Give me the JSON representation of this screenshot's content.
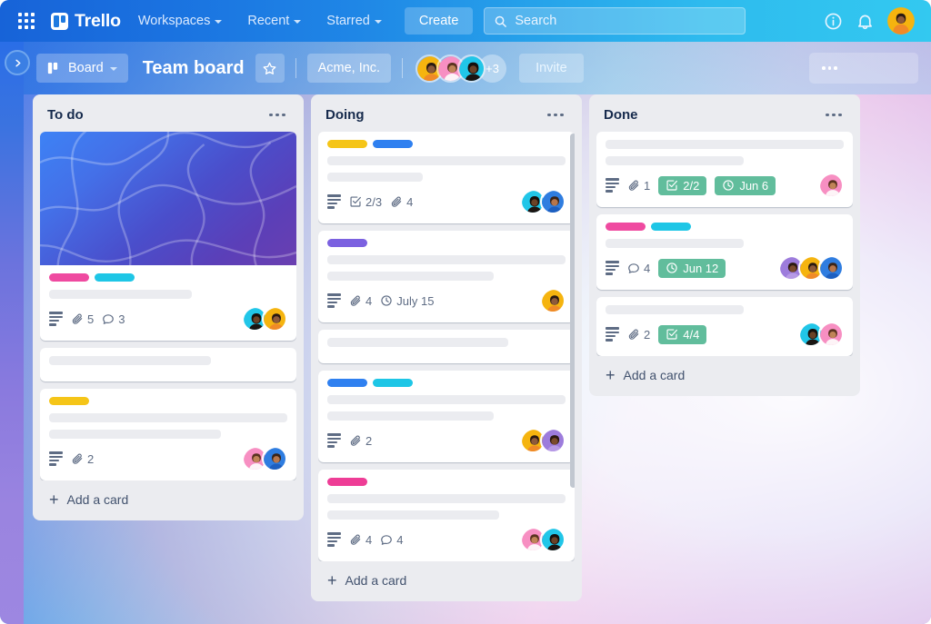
{
  "topnav": {
    "apps_icon": "grid-apps-icon",
    "brand": "Trello",
    "items": [
      {
        "label": "Workspaces",
        "icon": "chevron-down-icon"
      },
      {
        "label": "Recent",
        "icon": "chevron-down-icon"
      },
      {
        "label": "Starred",
        "icon": "chevron-down-icon"
      }
    ],
    "create_label": "Create",
    "search": {
      "placeholder": "Search",
      "icon": "search-icon",
      "value": ""
    },
    "info_icon": "info-circle-icon",
    "notifications_icon": "bell-icon",
    "profile_icon": "user-avatar"
  },
  "boardbar": {
    "sidebar_toggle_icon": "chevron-right-icon",
    "view_label": "Board",
    "view_icon": "board-view-icon",
    "view_caret": "chevron-down-icon",
    "title": "Team board",
    "star_icon": "star-outline-icon",
    "workspace": "Acme, Inc.",
    "member_overflow": "+3",
    "invite_label": "Invite",
    "menu_icon": "ellipsis-icon"
  },
  "colors": {
    "label_pink": "#ef4aa0",
    "label_cyan": "#1ec6e6",
    "label_yellow": "#f5c518",
    "label_blue": "#2f80f0",
    "label_purple": "#7b61e0",
    "label_magenta": "#ee3d96",
    "badge_green": "#61bd9c",
    "list_bg": "#ebecf0",
    "card_bg": "#ffffff",
    "text_dark": "#172b4d"
  },
  "lists": [
    {
      "title": "To do",
      "menu_icon": "ellipsis-icon",
      "add_card_label": "Add a card",
      "scrollbar": false,
      "cards": [
        {
          "cover": true,
          "labels": [
            "#ef4aa0",
            "#1ec6e6"
          ],
          "label_widths": [
            44,
            44
          ],
          "skeletons": [
            [
              60
            ]
          ],
          "badges": [
            {
              "type": "description"
            },
            {
              "type": "attachment",
              "value": "5"
            },
            {
              "type": "comment",
              "value": "3"
            }
          ],
          "avatars": [
            "teal",
            "yellow"
          ]
        },
        {
          "cover": false,
          "labels": [],
          "label_widths": [],
          "skeletons": [
            [
              68
            ]
          ],
          "badges": [],
          "avatars": []
        },
        {
          "cover": false,
          "labels": [
            "#f5c518"
          ],
          "label_widths": [
            44
          ],
          "skeletons": [
            [
              100
            ],
            [
              72
            ]
          ],
          "badges": [
            {
              "type": "description"
            },
            {
              "type": "attachment",
              "value": "2"
            }
          ],
          "avatars": [
            "pink",
            "blue"
          ]
        }
      ]
    },
    {
      "title": "Doing",
      "menu_icon": "ellipsis-icon",
      "add_card_label": "Add a card",
      "scrollbar": true,
      "cards": [
        {
          "cover": false,
          "labels": [
            "#f5c518",
            "#2f80f0"
          ],
          "label_widths": [
            44,
            44
          ],
          "skeletons": [
            [
              100
            ],
            [
              40
            ]
          ],
          "badges": [
            {
              "type": "description"
            },
            {
              "type": "checklist",
              "value": "2/3"
            },
            {
              "type": "attachment",
              "value": "4"
            }
          ],
          "avatars": [
            "teal",
            "blue"
          ]
        },
        {
          "cover": false,
          "labels": [
            "#7b61e0"
          ],
          "label_widths": [
            44
          ],
          "skeletons": [
            [
              100
            ],
            [
              70
            ]
          ],
          "badges": [
            {
              "type": "description"
            },
            {
              "type": "attachment",
              "value": "4"
            },
            {
              "type": "due",
              "value": "July 15"
            }
          ],
          "avatars": [
            "yellow"
          ]
        },
        {
          "cover": false,
          "labels": [],
          "label_widths": [],
          "skeletons": [
            [
              76
            ]
          ],
          "badges": [],
          "avatars": []
        },
        {
          "cover": false,
          "labels": [
            "#2f80f0",
            "#1ec6e6"
          ],
          "label_widths": [
            44,
            44
          ],
          "skeletons": [
            [
              100
            ],
            [
              70
            ]
          ],
          "badges": [
            {
              "type": "description"
            },
            {
              "type": "attachment",
              "value": "2"
            }
          ],
          "avatars": [
            "yellow",
            "purple"
          ]
        },
        {
          "cover": false,
          "labels": [
            "#ee3d96"
          ],
          "label_widths": [
            44
          ],
          "skeletons": [
            [
              100
            ],
            [
              72
            ]
          ],
          "badges": [
            {
              "type": "description"
            },
            {
              "type": "attachment",
              "value": "4"
            },
            {
              "type": "comment",
              "value": "4"
            }
          ],
          "avatars": [
            "pink",
            "teal"
          ]
        }
      ]
    },
    {
      "title": "Done",
      "menu_icon": "ellipsis-icon",
      "add_card_label": "Add a card",
      "scrollbar": false,
      "cards": [
        {
          "cover": false,
          "labels": [],
          "label_widths": [],
          "skeletons": [
            [
              100
            ],
            [
              58
            ]
          ],
          "badges": [
            {
              "type": "description"
            },
            {
              "type": "attachment",
              "value": "1"
            },
            {
              "type": "checklist-green",
              "value": "2/2"
            },
            {
              "type": "due-green",
              "value": "Jun 6"
            }
          ],
          "avatars": [
            "pink"
          ]
        },
        {
          "cover": false,
          "labels": [
            "#ef4aa0",
            "#1ec6e6"
          ],
          "label_widths": [
            44,
            44
          ],
          "skeletons": [
            [
              58
            ]
          ],
          "badges": [
            {
              "type": "description"
            },
            {
              "type": "comment",
              "value": "4"
            },
            {
              "type": "due-green",
              "value": "Jun 12"
            }
          ],
          "avatars": [
            "purple",
            "yellow",
            "blue"
          ]
        },
        {
          "cover": false,
          "labels": [],
          "label_widths": [],
          "skeletons": [
            [
              58
            ]
          ],
          "badges": [
            {
              "type": "description"
            },
            {
              "type": "attachment",
              "value": "2"
            },
            {
              "type": "checklist-green",
              "value": "4/4"
            }
          ],
          "avatars": [
            "teal",
            "pink"
          ]
        }
      ]
    }
  ]
}
